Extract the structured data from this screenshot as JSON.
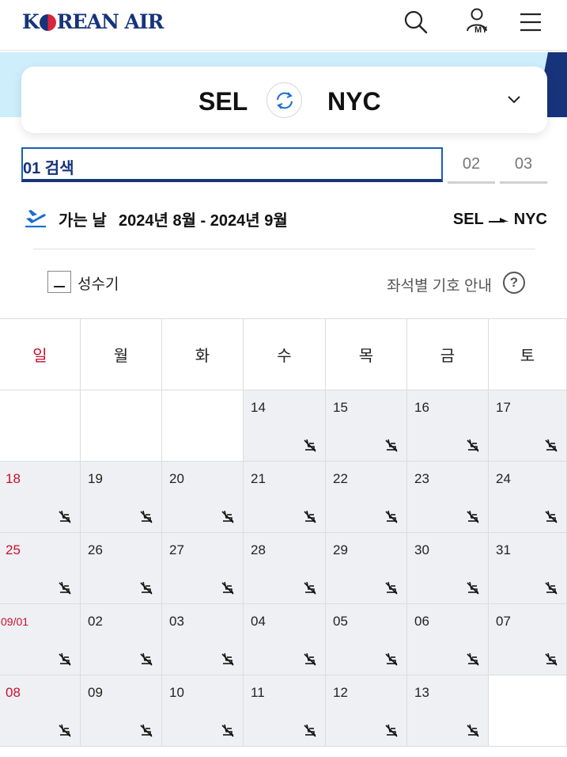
{
  "header": {
    "logo_text": "KOREAN AIR",
    "logo_parts": {
      "k": "K",
      "rest": "REAN AIR"
    },
    "icons": [
      "search-icon",
      "my-page-icon",
      "menu-icon"
    ],
    "my_label": "MY"
  },
  "route": {
    "departure": "SEL",
    "arrival": "NYC",
    "swap_icon": "swap-icon",
    "expand_icon": "chevron-down-icon"
  },
  "steps": {
    "active": "01  검색",
    "step2": "02",
    "step3": "03"
  },
  "departure_info": {
    "label": "가는 날",
    "range": "2024년 8월 - 2024년 9월",
    "from": "SEL",
    "to": "NYC"
  },
  "legend": {
    "peak_label": "성수기",
    "seat_guide": "좌석별 기호 안내",
    "help": "?"
  },
  "calendar": {
    "weekdays": [
      "일",
      "월",
      "화",
      "수",
      "목",
      "금",
      "토"
    ],
    "weeks": [
      [
        "",
        "",
        "",
        "14",
        "15",
        "16",
        "17"
      ],
      [
        "18",
        "19",
        "20",
        "21",
        "22",
        "23",
        "24"
      ],
      [
        "25",
        "26",
        "27",
        "28",
        "29",
        "30",
        "31"
      ],
      [
        "09/01",
        "02",
        "03",
        "04",
        "05",
        "06",
        "07"
      ],
      [
        "08",
        "09",
        "10",
        "11",
        "12",
        "13",
        ""
      ]
    ],
    "cell_icon": "no-seat-icon"
  },
  "colors": {
    "brand_navy": "#17337a",
    "accent_blue": "#1a5fb4",
    "sunday_red": "#c8102e",
    "band_sky": "#cdeefa",
    "cell_gray": "#eef0f3"
  }
}
